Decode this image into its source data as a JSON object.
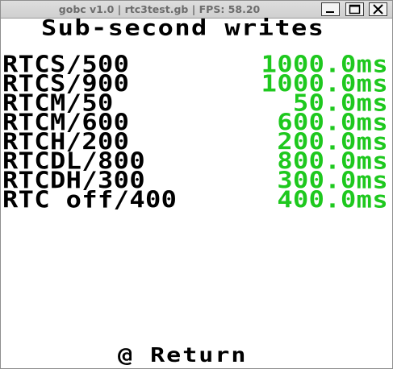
{
  "window": {
    "title": "gobc v1.0 | rtc3test.gb | FPS: 58.20"
  },
  "screen": {
    "heading": "Sub-second writes",
    "rows": [
      {
        "label": "RTCS/500",
        "value": "1000.0ms"
      },
      {
        "label": "RTCS/900",
        "value": "1000.0ms"
      },
      {
        "label": "RTCM/50",
        "value": "50.0ms"
      },
      {
        "label": "RTCM/600",
        "value": "600.0ms"
      },
      {
        "label": "RTCH/200",
        "value": "200.0ms"
      },
      {
        "label": "RTCDL/800",
        "value": "800.0ms"
      },
      {
        "label": "RTCDH/300",
        "value": "300.0ms"
      },
      {
        "label": "RTC off/400",
        "value": "400.0ms"
      }
    ],
    "footer": "@ Return"
  },
  "colors": {
    "value_text": "#1ec81e",
    "label_text": "#000000",
    "titlebar_text": "#6c6c6c"
  },
  "icons": {
    "minimize": "minimize-icon",
    "maximize": "maximize-icon",
    "close": "close-icon"
  }
}
